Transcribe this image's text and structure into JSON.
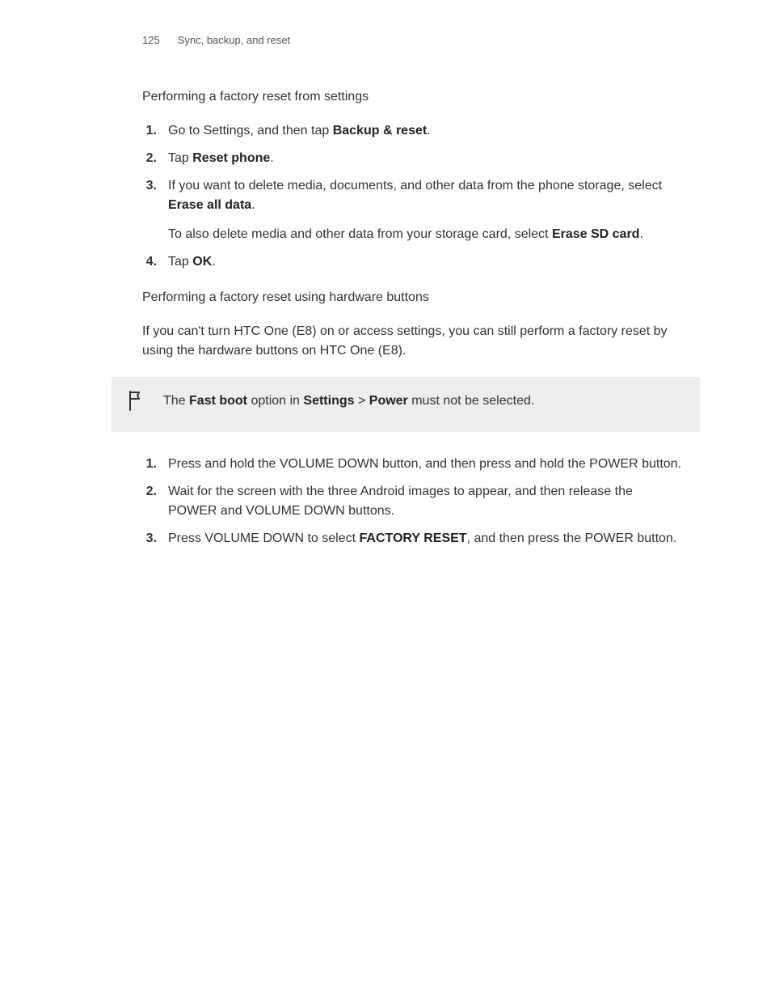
{
  "header": {
    "page_number": "125",
    "breadcrumb": "Sync, backup, and reset"
  },
  "section1": {
    "title": "Performing a factory reset from settings",
    "steps": [
      {
        "num": "1.",
        "p1_pre": "Go to Settings, and then tap ",
        "p1_bold": "Backup & reset",
        "p1_post": "."
      },
      {
        "num": "2.",
        "p1_pre": "Tap ",
        "p1_bold": "Reset phone",
        "p1_post": "."
      },
      {
        "num": "3.",
        "p1_pre": "If you want to delete media, documents, and other data from the phone storage, select ",
        "p1_bold": "Erase all data",
        "p1_post": ".",
        "p2_pre": "To also delete media and other data from your storage card, select ",
        "p2_bold": "Erase SD card",
        "p2_post": "."
      },
      {
        "num": "4.",
        "p1_pre": "Tap ",
        "p1_bold": "OK",
        "p1_post": "."
      }
    ]
  },
  "section2": {
    "title": "Performing a factory reset using hardware buttons",
    "intro": "If you can't turn HTC One (E8) on or access settings, you can still perform a factory reset by using the hardware buttons on HTC One (E8).",
    "callout_pre": "The ",
    "callout_b1": "Fast boot",
    "callout_mid1": " option in ",
    "callout_b2": "Settings",
    "callout_mid2": " > ",
    "callout_b3": "Power",
    "callout_post": " must not be selected.",
    "steps": [
      {
        "num": "1.",
        "text": "Press and hold the VOLUME DOWN button, and then press and hold the POWER button."
      },
      {
        "num": "2.",
        "text": "Wait for the screen with the three Android images to appear, and then release the POWER and VOLUME DOWN buttons."
      },
      {
        "num": "3.",
        "p_pre": "Press VOLUME DOWN to select ",
        "p_bold": "FACTORY RESET",
        "p_post": ", and then press the POWER button."
      }
    ]
  }
}
